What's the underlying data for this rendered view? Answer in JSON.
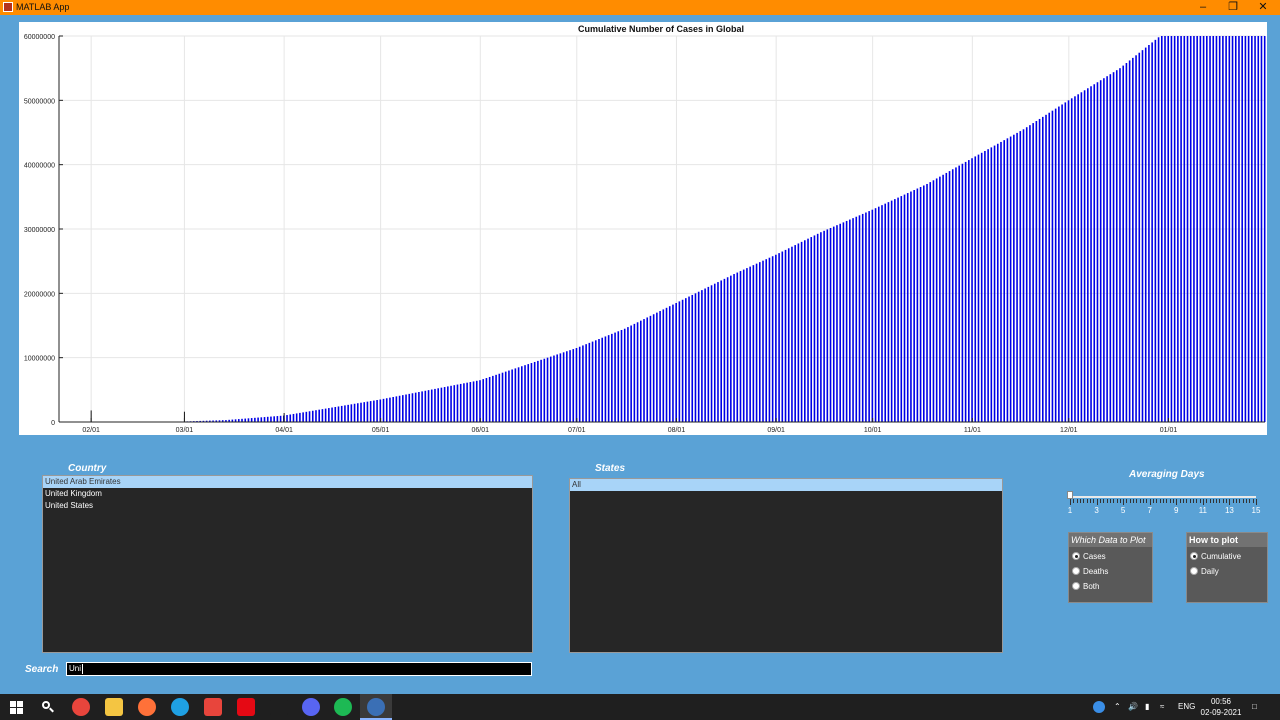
{
  "window": {
    "title": "MATLAB App"
  },
  "chart_data": {
    "type": "bar",
    "title": "Cumulative Number of Cases in Global",
    "ylim": [
      0,
      60000000
    ],
    "ytick_labels": [
      "0",
      "10000000",
      "20000000",
      "30000000",
      "40000000",
      "50000000",
      "60000000"
    ],
    "xtick_labels": [
      "02/01",
      "03/01",
      "04/01",
      "05/01",
      "06/01",
      "07/01",
      "08/01",
      "09/01",
      "10/01",
      "11/01",
      "12/01",
      "01/01"
    ],
    "xtick_days": [
      10,
      39,
      70,
      100,
      131,
      161,
      192,
      223,
      253,
      284,
      314,
      345
    ],
    "x_range_days": [
      0,
      375
    ],
    "grid": true,
    "bar_color": "#0000e6",
    "anchor_points": [
      [
        0,
        0
      ],
      [
        10,
        10000
      ],
      [
        39,
        85000
      ],
      [
        52,
        300000
      ],
      [
        70,
        1000000
      ],
      [
        100,
        3500000
      ],
      [
        131,
        6500000
      ],
      [
        161,
        11500000
      ],
      [
        176,
        14500000
      ],
      [
        192,
        18500000
      ],
      [
        210,
        23000000
      ],
      [
        223,
        26000000
      ],
      [
        237,
        29500000
      ],
      [
        253,
        33000000
      ],
      [
        270,
        37000000
      ],
      [
        284,
        41000000
      ],
      [
        300,
        45500000
      ],
      [
        314,
        50000000
      ],
      [
        330,
        55000000
      ],
      [
        345,
        61000000
      ],
      [
        360,
        67000000
      ],
      [
        375,
        72000000
      ]
    ]
  },
  "country": {
    "label": "Country",
    "items": [
      "United Arab Emirates",
      "United Kingdom",
      "United States"
    ],
    "selected_index": 0
  },
  "states": {
    "label": "States",
    "items": [
      "All"
    ],
    "selected_index": 0
  },
  "search": {
    "label": "Search",
    "value": "Uni"
  },
  "averaging": {
    "label": "Averaging Days",
    "min": 1,
    "max": 15,
    "value": 1,
    "tick_labels": [
      "1",
      "3",
      "5",
      "7",
      "9",
      "11",
      "13",
      "15"
    ]
  },
  "which_data": {
    "title": "Which Data to Plot",
    "options": [
      "Cases",
      "Deaths",
      "Both"
    ],
    "selected": "Cases"
  },
  "how_to_plot": {
    "title": "How to plot",
    "options": [
      "Cumulative",
      "Daily"
    ],
    "selected": "Cumulative"
  },
  "taskbar": {
    "time": "00:56",
    "date": "02-09-2021",
    "lang": "ENG",
    "icons": [
      "windows-start-icon",
      "search-icon",
      "chrome-icon",
      "file-explorer-icon",
      "firefox-icon",
      "edge-icon",
      "app-icon",
      "netflix-icon",
      "prime-video-icon",
      "discord-icon",
      "spotify-icon",
      "matlab-icon"
    ]
  }
}
